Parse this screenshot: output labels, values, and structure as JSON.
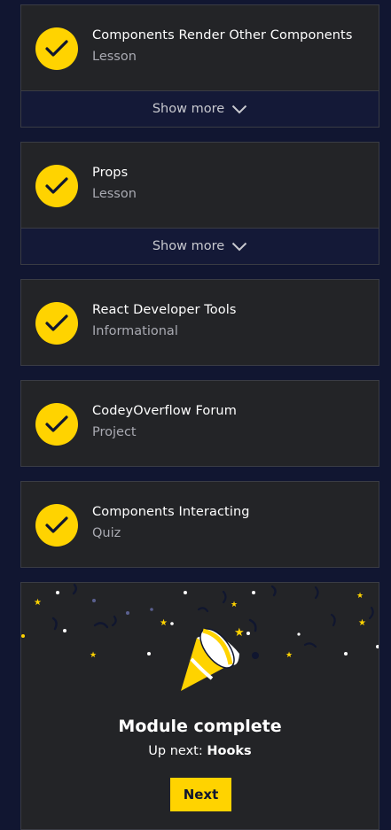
{
  "items": [
    {
      "title": "Components Render Other Components",
      "type": "Lesson",
      "show_more": "Show more"
    },
    {
      "title": "Props",
      "type": "Lesson",
      "show_more": "Show more"
    },
    {
      "title": "React Developer Tools",
      "type": "Informational"
    },
    {
      "title": "CodeyOverflow Forum",
      "type": "Project"
    },
    {
      "title": "Components Interacting",
      "type": "Quiz"
    }
  ],
  "module": {
    "title": "Module complete",
    "up_next_label": "Up next:",
    "up_next_name": "Hooks",
    "next_button": "Next"
  },
  "icons": {
    "completed": "checkmark-icon",
    "expand": "chevron-down-icon",
    "celebration": "party-popper-icon"
  },
  "colors": {
    "accent": "#ffd300",
    "page_bg": "#111631",
    "card_bg": "#232427"
  }
}
